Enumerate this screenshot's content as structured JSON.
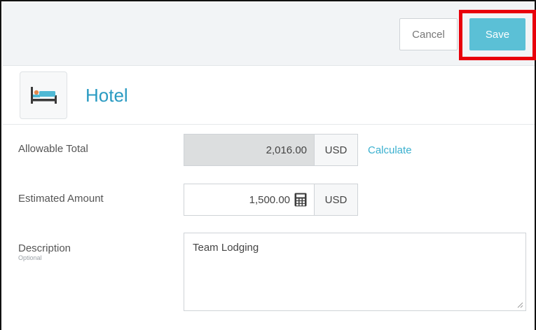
{
  "toolbar": {
    "cancel_label": "Cancel",
    "save_label": "Save"
  },
  "header": {
    "title": "Hotel",
    "icon": "hotel-bed-icon"
  },
  "form": {
    "allowable_total": {
      "label": "Allowable Total",
      "value": "2,016.00",
      "currency": "USD",
      "action_label": "Calculate"
    },
    "estimated_amount": {
      "label": "Estimated Amount",
      "value": "1,500.00",
      "currency": "USD",
      "icon": "calculator-icon"
    },
    "description": {
      "label": "Description",
      "sublabel": "Optional",
      "value": "Team Lodging"
    }
  },
  "colors": {
    "accent": "#5bc0d6",
    "title": "#2a9bc2",
    "link": "#3ab0cf",
    "highlight": "#e8000b"
  }
}
